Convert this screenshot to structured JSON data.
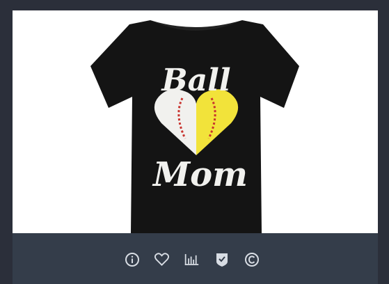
{
  "product": {
    "shirt_text_top": "Ball",
    "shirt_text_bottom": "Mom",
    "shirt_color": "#141414",
    "text_color": "#f1f1ee",
    "softball_color": "#f2e33a",
    "stitch_color": "#c8332e"
  },
  "toolbar": {
    "icons": [
      "info-icon",
      "heart-icon",
      "bar-chart-icon",
      "shield-check-icon",
      "copyright-icon"
    ],
    "icon_color": "#d8dde4"
  },
  "colors": {
    "page_bg": "#2b2f3a",
    "toolbar_bg": "#343d4a",
    "image_bg": "#ffffff"
  }
}
